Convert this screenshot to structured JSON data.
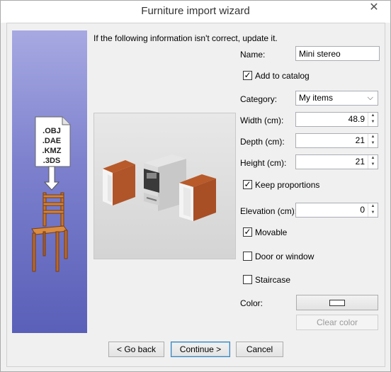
{
  "window": {
    "title": "Furniture import wizard",
    "close_glyph": "✕"
  },
  "side_panel": {
    "formats": [
      ".OBJ",
      ".DAE",
      ".KMZ",
      ".3DS"
    ]
  },
  "intro": "If the following information isn't correct, update it.",
  "form": {
    "name_label": "Name:",
    "name_value": "Mini stereo",
    "add_to_catalog_label": "Add to catalog",
    "add_to_catalog_checked": true,
    "category_label": "Category:",
    "category_value": "My items",
    "width_label": "Width (cm):",
    "width_value": "48.9",
    "depth_label": "Depth (cm):",
    "depth_value": "21",
    "height_label": "Height (cm):",
    "height_value": "21",
    "keep_proportions_label": "Keep proportions",
    "keep_proportions_checked": true,
    "elevation_label": "Elevation (cm):",
    "elevation_value": "0",
    "movable_label": "Movable",
    "movable_checked": true,
    "door_or_window_label": "Door or window",
    "door_or_window_checked": false,
    "staircase_label": "Staircase",
    "staircase_checked": false,
    "color_label": "Color:",
    "clear_color_label": "Clear color"
  },
  "footer": {
    "back_label": "< Go back",
    "continue_label": "Continue >",
    "cancel_label": "Cancel"
  },
  "icons": {
    "close": "close-icon",
    "dropdown": "chevron-down-icon",
    "spin": "spin-arrows-icon"
  }
}
